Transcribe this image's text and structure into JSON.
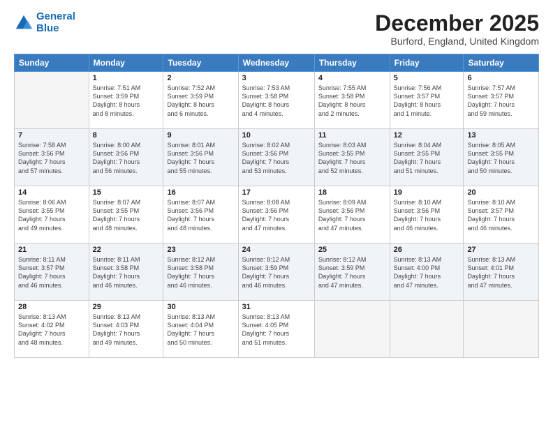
{
  "logo": {
    "line1": "General",
    "line2": "Blue"
  },
  "header": {
    "title": "December 2025",
    "location": "Burford, England, United Kingdom"
  },
  "days_of_week": [
    "Sunday",
    "Monday",
    "Tuesday",
    "Wednesday",
    "Thursday",
    "Friday",
    "Saturday"
  ],
  "weeks": [
    [
      {
        "num": "",
        "info": ""
      },
      {
        "num": "1",
        "info": "Sunrise: 7:51 AM\nSunset: 3:59 PM\nDaylight: 8 hours\nand 8 minutes."
      },
      {
        "num": "2",
        "info": "Sunrise: 7:52 AM\nSunset: 3:59 PM\nDaylight: 8 hours\nand 6 minutes."
      },
      {
        "num": "3",
        "info": "Sunrise: 7:53 AM\nSunset: 3:58 PM\nDaylight: 8 hours\nand 4 minutes."
      },
      {
        "num": "4",
        "info": "Sunrise: 7:55 AM\nSunset: 3:58 PM\nDaylight: 8 hours\nand 2 minutes."
      },
      {
        "num": "5",
        "info": "Sunrise: 7:56 AM\nSunset: 3:57 PM\nDaylight: 8 hours\nand 1 minute."
      },
      {
        "num": "6",
        "info": "Sunrise: 7:57 AM\nSunset: 3:57 PM\nDaylight: 7 hours\nand 59 minutes."
      }
    ],
    [
      {
        "num": "7",
        "info": "Sunrise: 7:58 AM\nSunset: 3:56 PM\nDaylight: 7 hours\nand 57 minutes."
      },
      {
        "num": "8",
        "info": "Sunrise: 8:00 AM\nSunset: 3:56 PM\nDaylight: 7 hours\nand 56 minutes."
      },
      {
        "num": "9",
        "info": "Sunrise: 8:01 AM\nSunset: 3:56 PM\nDaylight: 7 hours\nand 55 minutes."
      },
      {
        "num": "10",
        "info": "Sunrise: 8:02 AM\nSunset: 3:56 PM\nDaylight: 7 hours\nand 53 minutes."
      },
      {
        "num": "11",
        "info": "Sunrise: 8:03 AM\nSunset: 3:55 PM\nDaylight: 7 hours\nand 52 minutes."
      },
      {
        "num": "12",
        "info": "Sunrise: 8:04 AM\nSunset: 3:55 PM\nDaylight: 7 hours\nand 51 minutes."
      },
      {
        "num": "13",
        "info": "Sunrise: 8:05 AM\nSunset: 3:55 PM\nDaylight: 7 hours\nand 50 minutes."
      }
    ],
    [
      {
        "num": "14",
        "info": "Sunrise: 8:06 AM\nSunset: 3:55 PM\nDaylight: 7 hours\nand 49 minutes."
      },
      {
        "num": "15",
        "info": "Sunrise: 8:07 AM\nSunset: 3:55 PM\nDaylight: 7 hours\nand 48 minutes."
      },
      {
        "num": "16",
        "info": "Sunrise: 8:07 AM\nSunset: 3:56 PM\nDaylight: 7 hours\nand 48 minutes."
      },
      {
        "num": "17",
        "info": "Sunrise: 8:08 AM\nSunset: 3:56 PM\nDaylight: 7 hours\nand 47 minutes."
      },
      {
        "num": "18",
        "info": "Sunrise: 8:09 AM\nSunset: 3:56 PM\nDaylight: 7 hours\nand 47 minutes."
      },
      {
        "num": "19",
        "info": "Sunrise: 8:10 AM\nSunset: 3:56 PM\nDaylight: 7 hours\nand 46 minutes."
      },
      {
        "num": "20",
        "info": "Sunrise: 8:10 AM\nSunset: 3:57 PM\nDaylight: 7 hours\nand 46 minutes."
      }
    ],
    [
      {
        "num": "21",
        "info": "Sunrise: 8:11 AM\nSunset: 3:57 PM\nDaylight: 7 hours\nand 46 minutes."
      },
      {
        "num": "22",
        "info": "Sunrise: 8:11 AM\nSunset: 3:58 PM\nDaylight: 7 hours\nand 46 minutes."
      },
      {
        "num": "23",
        "info": "Sunrise: 8:12 AM\nSunset: 3:58 PM\nDaylight: 7 hours\nand 46 minutes."
      },
      {
        "num": "24",
        "info": "Sunrise: 8:12 AM\nSunset: 3:59 PM\nDaylight: 7 hours\nand 46 minutes."
      },
      {
        "num": "25",
        "info": "Sunrise: 8:12 AM\nSunset: 3:59 PM\nDaylight: 7 hours\nand 47 minutes."
      },
      {
        "num": "26",
        "info": "Sunrise: 8:13 AM\nSunset: 4:00 PM\nDaylight: 7 hours\nand 47 minutes."
      },
      {
        "num": "27",
        "info": "Sunrise: 8:13 AM\nSunset: 4:01 PM\nDaylight: 7 hours\nand 47 minutes."
      }
    ],
    [
      {
        "num": "28",
        "info": "Sunrise: 8:13 AM\nSunset: 4:02 PM\nDaylight: 7 hours\nand 48 minutes."
      },
      {
        "num": "29",
        "info": "Sunrise: 8:13 AM\nSunset: 4:03 PM\nDaylight: 7 hours\nand 49 minutes."
      },
      {
        "num": "30",
        "info": "Sunrise: 8:13 AM\nSunset: 4:04 PM\nDaylight: 7 hours\nand 50 minutes."
      },
      {
        "num": "31",
        "info": "Sunrise: 8:13 AM\nSunset: 4:05 PM\nDaylight: 7 hours\nand 51 minutes."
      },
      {
        "num": "",
        "info": ""
      },
      {
        "num": "",
        "info": ""
      },
      {
        "num": "",
        "info": ""
      }
    ]
  ]
}
